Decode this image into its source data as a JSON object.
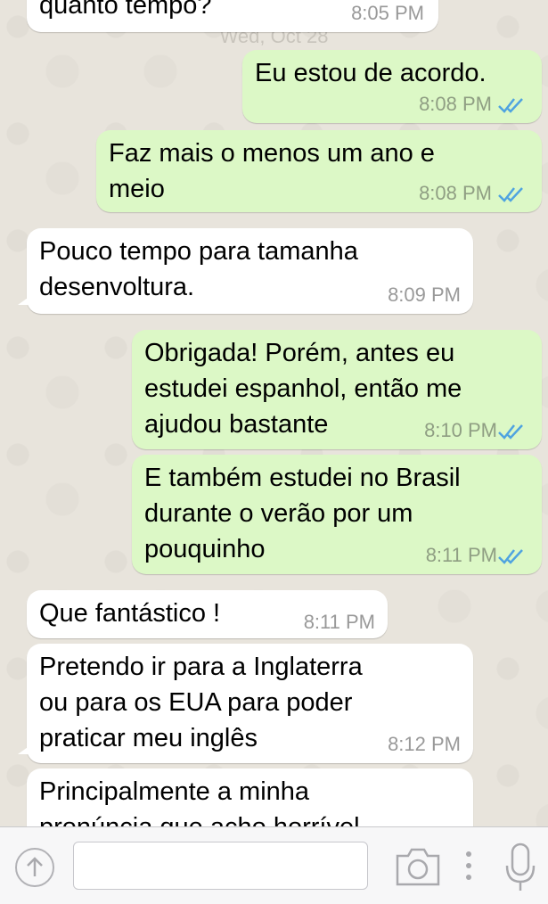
{
  "date_divider": "Wed, Oct 28",
  "messages": [
    {
      "dir": "in",
      "text": "quanto tempo?",
      "time": "8:05 PM"
    },
    {
      "dir": "out",
      "text": "Eu estou de acordo.",
      "time": "8:08 PM"
    },
    {
      "dir": "out",
      "text": "Faz mais o menos um ano e\nmeio",
      "time": "8:08 PM"
    },
    {
      "dir": "in",
      "text": "Pouco tempo para tamanha\ndesenvoltura.",
      "time": "8:09 PM"
    },
    {
      "dir": "out",
      "text": "Obrigada! Porém, antes eu\nestudei espanhol, então me\najudou bastante",
      "time": "8:10 PM"
    },
    {
      "dir": "out",
      "text": "E também estudei no Brasil\ndurante o verão por um\npouquinho",
      "time": "8:11 PM"
    },
    {
      "dir": "in",
      "text": "Que fantástico !",
      "time": "8:11 PM"
    },
    {
      "dir": "in",
      "text": "Pretendo ir para a Inglaterra\nou para os EUA para poder\npraticar meu inglês",
      "time": "8:12 PM"
    },
    {
      "dir": "in",
      "text": "Principalmente a minha\npronúncia que acho horrível",
      "time": ""
    }
  ],
  "composer": {
    "value": ""
  },
  "colors": {
    "incoming": "#ffffff",
    "outgoing": "#dcf8c6",
    "read_ticks": "#4fa3e0"
  },
  "icons": [
    "upload-arrow-icon",
    "camera-icon",
    "more-dots-icon",
    "microphone-icon",
    "double-check-icon"
  ]
}
